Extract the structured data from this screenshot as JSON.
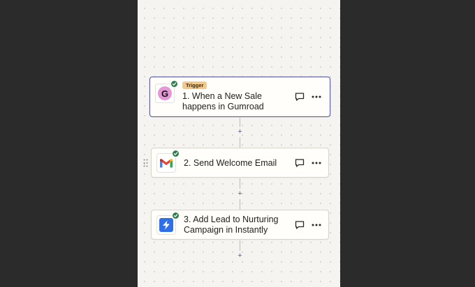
{
  "workflow": {
    "steps": [
      {
        "badge": "Trigger",
        "title": "1. When a New Sale happens in Gumroad",
        "app": "gumroad-icon",
        "status": "complete",
        "selected": true
      },
      {
        "title": "2. Send Welcome Email",
        "app": "gmail-icon",
        "status": "complete",
        "selected": false
      },
      {
        "title": "3. Add Lead to Nurturing Campaign in Instantly",
        "app": "instantly-icon",
        "status": "complete",
        "selected": false
      }
    ],
    "add_step_label": "+",
    "gumroad_letter": "G"
  },
  "colors": {
    "selected_border": "#5c5fa8",
    "check_green": "#2f7d51",
    "trigger_badge": "#f3c98b",
    "gumroad_pink": "#e598d5",
    "instantly_blue": "#2f6fe8",
    "plus_color": "#5a5d9f"
  }
}
